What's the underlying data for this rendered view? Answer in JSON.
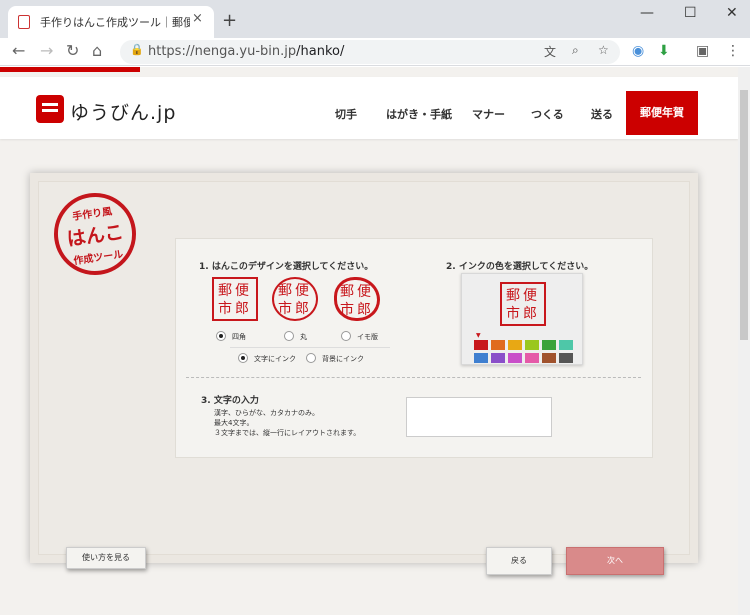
{
  "browser": {
    "tab_title": "手作りはんこ作成ツール｜郵便年賀",
    "tab_close": "×",
    "new_tab": "+",
    "url_host": "https://nenga.yu-bin.jp",
    "url_path": "/hanko/",
    "window_controls": [
      "—",
      "☐",
      "✕"
    ],
    "nav_icons": [
      "arrow-left",
      "arrow-right",
      "reload",
      "home"
    ],
    "omnibox_icons": [
      "translate",
      "zoom",
      "star"
    ],
    "extension_icons": [
      "chrome-extension",
      "download",
      "profile",
      "menu"
    ]
  },
  "site": {
    "logo_text": "ゆうびん.jp",
    "nav": [
      "切手",
      "はがき・手紙",
      "マナー",
      "つくる",
      "送る"
    ],
    "nav_highlight": "郵便年賀",
    "accent_color": "#cc0000"
  },
  "tool": {
    "logo_line1": "手作り風",
    "logo_line2": "はんこ",
    "logo_line3": "作成ツール",
    "section1_title": "1. はんこのデザインを選択してください。",
    "section2_title": "2. インクの色を選択してください。",
    "section3_title": "3. 文字の入力",
    "section3_desc": [
      "漢字、ひらがな、カタカナのみ。",
      "最大4文字。",
      "３文字までは、縦一行にレイアウトされます。"
    ],
    "stamp_chars": "郵便市郎",
    "designs": [
      {
        "label": "四角",
        "selected": true
      },
      {
        "label": "丸",
        "selected": false
      },
      {
        "label": "イモ版",
        "selected": false
      }
    ],
    "ink_modes": [
      {
        "label": "文字にインク",
        "selected": true
      },
      {
        "label": "背景にインク",
        "selected": false
      }
    ],
    "ink_colors": [
      "#c8171c",
      "#e06b1e",
      "#e8a814",
      "#9ac71e",
      "#3aa33a",
      "#4ec7a8",
      "#3f7fd0",
      "#8a4fc9",
      "#c94fc9",
      "#e55aa8",
      "#a0522d",
      "#555555"
    ],
    "selected_color": "#c8171c",
    "text_input_value": "",
    "buttons": {
      "howto": "使い方を見る",
      "back": "戻る",
      "next": "次へ"
    }
  }
}
